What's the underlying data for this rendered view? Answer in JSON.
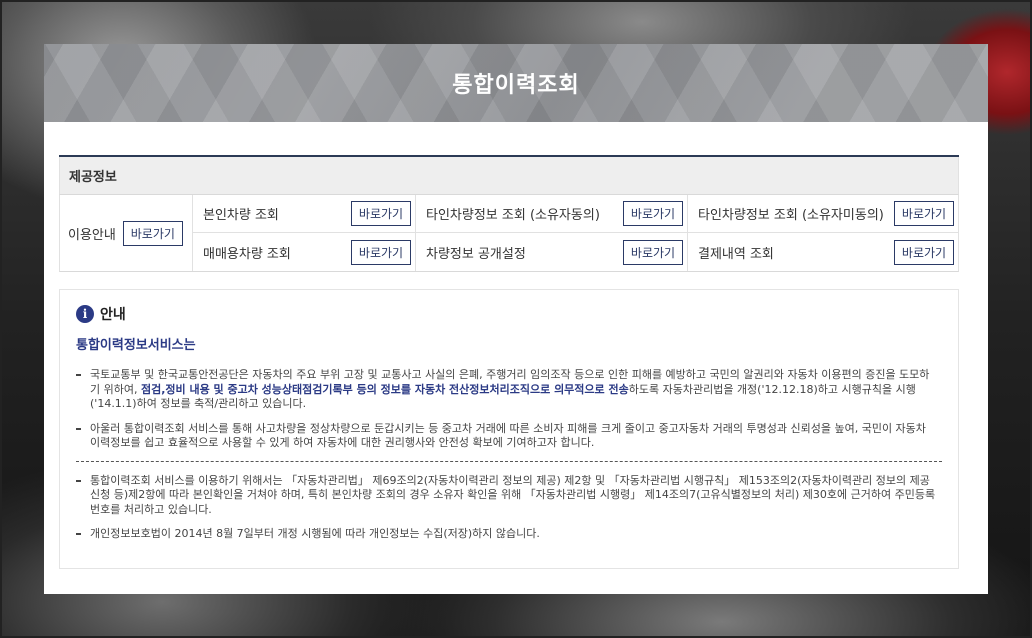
{
  "header": {
    "title": "통합이력조회"
  },
  "info": {
    "title": "제공정보",
    "guide_label": "이용안내",
    "go_label": "바로가기",
    "items": [
      {
        "label": "본인차량 조회"
      },
      {
        "label": "타인차량정보 조회 (소유자동의)"
      },
      {
        "label": "타인차량정보 조회 (소유자미동의)"
      },
      {
        "label": "매매용차량 조회"
      },
      {
        "label": "차량정보 공개설정"
      },
      {
        "label": "결제내역 조회"
      }
    ]
  },
  "notice": {
    "title": "안내",
    "icon": "info-icon",
    "subtitle": "통합이력정보서비스는",
    "para1_a": "국토교통부 및 한국교통안전공단은 자동차의 주요 부위 고장 및 교통사고 사실의 은폐, 주행거리 임의조작 등으로 인한 피해를 예방하고 국민의 알권리와 자동차 이용편의 증진을 도모하기 위하여, ",
    "para1_bold": "점검,정비 내용 및 중고차 성능상태점검기록부 등의 정보를 자동차 전산정보처리조직으로 의무적으로 전송",
    "para1_c": "하도록 자동차관리법을 개정('12.12.18)하고 시행규칙을 시행('14.1.1)하여 정보를 축적/관리하고 있습니다.",
    "para2": "아울러 통합이력조회 서비스를 통해 사고차량을 정상차량으로 둔갑시키는 등 중고차 거래에 따른 소비자 피해를 크게 줄이고 중고자동차 거래의 투명성과 신뢰성을 높여, 국민이 자동차 이력정보를 쉽고 효율적으로 사용할 수 있게 하여 자동차에 대한 권리행사와 안전성 확보에 기여하고자 합니다.",
    "para3": "통합이력조회 서비스를 이용하기 위해서는 「자동차관리법」 제69조의2(자동차이력관리 정보의 제공) 제2항 및 「자동차관리법 시행규칙」 제153조의2(자동차이력관리 정보의 제공신청 등)제2항에 따라 본인확인을 거쳐야 하며, 특히 본인차량 조회의 경우 소유자 확인을 위해 「자동차관리법 시행령」 제14조의7(고유식별정보의 처리) 제30호에 근거하여 주민등록번호를 처리하고 있습니다.",
    "para4": "개인정보보호법이 2014년 8월 7일부터 개정 시행됨에 따라 개인정보는 수집(저장)하지 않습니다."
  }
}
